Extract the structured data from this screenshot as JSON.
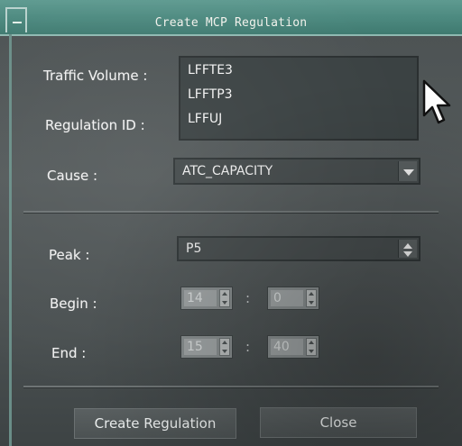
{
  "window": {
    "title": "Create MCP Regulation"
  },
  "labels": {
    "traffic_volume": "Traffic Volume :",
    "regulation_id": "Regulation ID :",
    "cause": "Cause :",
    "peak": "Peak :",
    "begin": "Begin :",
    "end": "End :"
  },
  "traffic_volume_list": [
    "LFFTE3",
    "LFFTP3",
    "LFFUJ"
  ],
  "cause": {
    "selected": "ATC_CAPACITY"
  },
  "peak": {
    "selected": "P5"
  },
  "begin": {
    "hour": "14",
    "minute": "0",
    "separator": ":"
  },
  "end": {
    "hour": "15",
    "minute": "40",
    "separator": ":"
  },
  "buttons": {
    "create": "Create Regulation",
    "close": "Close"
  },
  "icons": {
    "cursor": "mouse-pointer-icon",
    "combo_arrow": "chevron-down-icon",
    "spinner": "up-down-arrows-icon"
  }
}
